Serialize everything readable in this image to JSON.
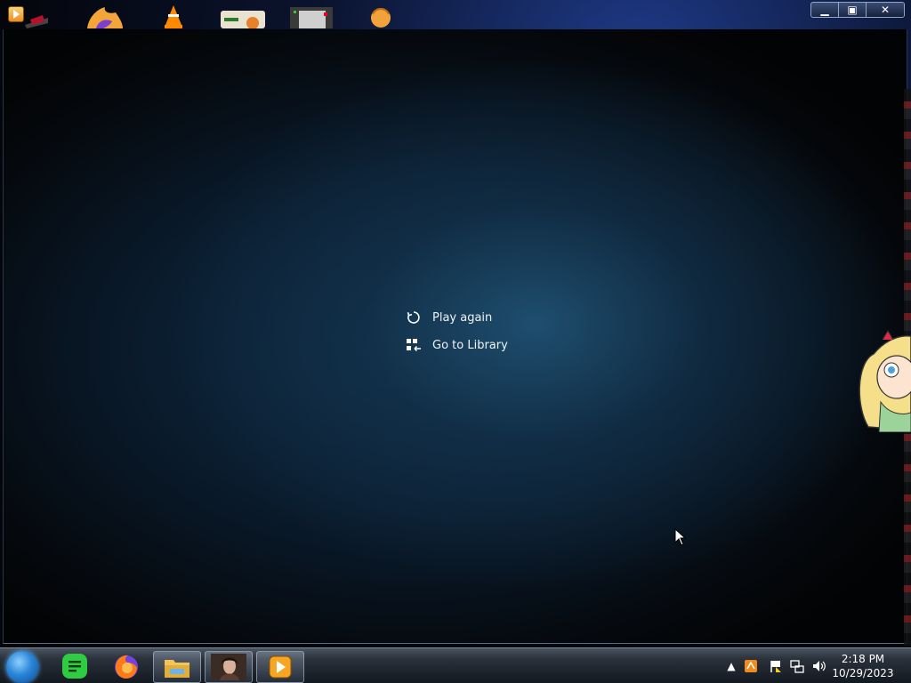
{
  "desktop": {
    "icons": [
      {
        "name": "hat-icon"
      },
      {
        "name": "firefox-dev-icon"
      },
      {
        "name": "vlc-icon"
      },
      {
        "name": "game-icon"
      },
      {
        "name": "pixel-window-icon"
      },
      {
        "name": "orange-head-icon"
      }
    ]
  },
  "window": {
    "app_icon": "media-player-icon",
    "controls": {
      "minimize": "▁",
      "maximize": "▣",
      "close": "✕"
    }
  },
  "player": {
    "menu": {
      "play_again": "Play again",
      "go_to_library": "Go to Library"
    }
  },
  "taskbar": {
    "start": "start-orb-icon",
    "items": [
      {
        "name": "notes-app-icon",
        "color": "#2ecc40"
      },
      {
        "name": "firefox-icon"
      },
      {
        "name": "file-explorer-icon"
      },
      {
        "name": "portrait-app-icon"
      },
      {
        "name": "media-player-icon"
      }
    ],
    "tray": {
      "show_hidden": "▲",
      "clock_time": "2:18 PM",
      "clock_date": "10/29/2023"
    }
  },
  "colors": {
    "accent": "#f08c1d",
    "taskbar_bg": "#2a313a"
  }
}
